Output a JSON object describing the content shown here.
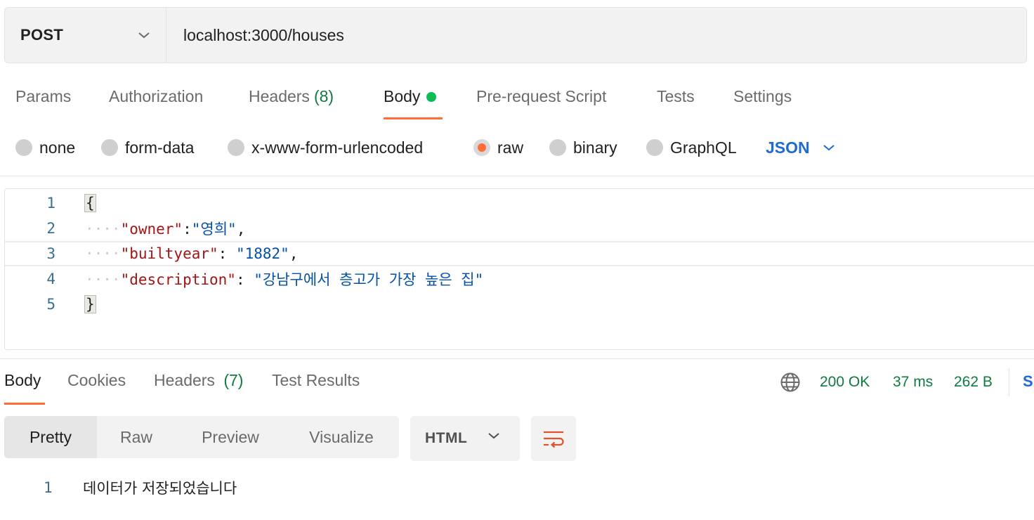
{
  "request": {
    "method": "POST",
    "url": "localhost:3000/houses"
  },
  "request_tabs": [
    {
      "label": "Params"
    },
    {
      "label": "Authorization"
    },
    {
      "label": "Headers",
      "count": "(8)"
    },
    {
      "label": "Body",
      "active": true,
      "has_dot": true
    },
    {
      "label": "Pre-request Script"
    },
    {
      "label": "Tests"
    },
    {
      "label": "Settings"
    }
  ],
  "body_types": [
    {
      "label": "none",
      "checked": false
    },
    {
      "label": "form-data",
      "checked": false
    },
    {
      "label": "x-www-form-urlencoded",
      "checked": false
    },
    {
      "label": "raw",
      "checked": true
    },
    {
      "label": "binary",
      "checked": false
    },
    {
      "label": "GraphQL",
      "checked": false
    }
  ],
  "raw_format": "JSON",
  "editor": {
    "line_numbers": [
      "1",
      "2",
      "3",
      "4",
      "5"
    ],
    "open_brace": "{",
    "close_brace": "}",
    "lines": [
      {
        "key": "\"owner\"",
        "sep": ":",
        "value": "\"영희\"",
        "trail": ","
      },
      {
        "key": "\"builtyear\"",
        "sep": ": ",
        "value": "\"1882\"",
        "trail": ","
      },
      {
        "key": "\"description\"",
        "sep": ": ",
        "value": "\"강남구에서 층고가 가장 높은 집\"",
        "trail": ""
      }
    ]
  },
  "response_tabs": [
    {
      "label": "Body",
      "active": true
    },
    {
      "label": "Cookies"
    },
    {
      "label": "Headers",
      "count": "(7)"
    },
    {
      "label": "Test Results"
    }
  ],
  "response_status": {
    "status": "200 OK",
    "time": "37 ms",
    "size": "262 B",
    "save_partial": "S"
  },
  "view_modes": [
    "Pretty",
    "Raw",
    "Preview",
    "Visualize"
  ],
  "active_view_mode": "Pretty",
  "response_format": "HTML",
  "response_body": {
    "line_number": "1",
    "text": "데이터가 저장되었습니다"
  },
  "colors": {
    "accent": "#ff6c37",
    "status_green": "#0f7b3f",
    "link_blue": "#1f6bd1",
    "body_dot": "#0cbb52"
  }
}
